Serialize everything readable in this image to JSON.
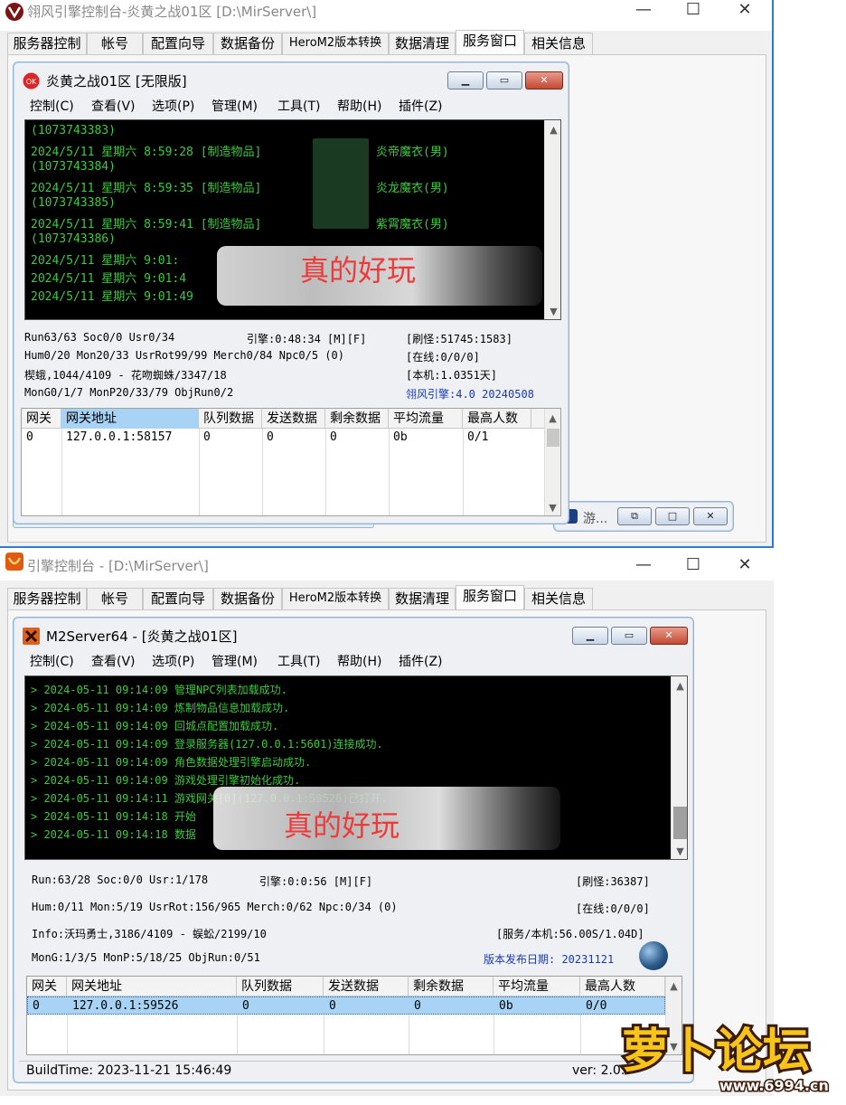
{
  "top_window": {
    "title": "翎风引擎控制台-炎黄之战01区 [D:\\MirServer\\]",
    "caption": {
      "minimize": "—",
      "maximize": "☐",
      "close": "✕"
    },
    "tabs": [
      "服务器控制",
      "帐号",
      "配置向导",
      "数据备份",
      "HeroM2版本转换",
      "数据清理",
      "服务窗口",
      "相关信息"
    ],
    "active_tab": "服务窗口",
    "child": {
      "title": "炎黄之战01区 [无限版]",
      "menus": [
        "控制(C)",
        "查看(V)",
        "选项(P)",
        "管理(M)",
        "工具(T)",
        "帮助(H)",
        "插件(Z)"
      ],
      "log": [
        "(1073743383)",
        "2024/5/11 星期六 8:59:28 [制造物品]",
        "(1073743384)",
        "2024/5/11 星期六 8:59:35 [制造物品]",
        "(1073743385)",
        "2024/5/11 星期六 8:59:41 [制造物品]",
        "(1073743386)",
        "2024/5/11 星期六 9:01:",
        "2024/5/11 星期六 9:01:4",
        "2024/5/11 星期六 9:01:49"
      ],
      "log_tail": [
        "炎帝魔衣(男)",
        "炎龙魔衣(男)",
        "紫霄魔衣(男)"
      ],
      "status": {
        "l1": "Run63/63 Soc0/0 Usr0/34",
        "engine": "引擎:0:48:34 [M][F]",
        "r1": "[刷怪:51745:1583]",
        "l2": "Hum0/20 Mon20/33 UsrRot99/99 Merch0/84 Npc0/5 (0)",
        "r2": "[在线:0/0/0]",
        "l3": "楔蛾,1044/4109 - 花吻蜘蛛/3347/18",
        "r3": "[本机:1.0351天]",
        "l4": "MonG0/1/7 MonP20/33/79 ObjRun0/2",
        "r4": "翎风引擎:4.0 20240508"
      },
      "grid": {
        "headers": [
          "网关",
          "网关地址",
          "队列数据",
          "发送数据",
          "剩余数据",
          "平均流量",
          "最高人数"
        ],
        "row": [
          "0",
          "127.0.0.1:58157",
          "0",
          "0",
          "0",
          "0b",
          "0/1"
        ]
      }
    },
    "minimized_window": {
      "title": "游..."
    }
  },
  "bottom_window": {
    "title": "引擎控制台 - [D:\\MirServer\\]",
    "caption": {
      "minimize": "—",
      "maximize": "☐",
      "close": "✕"
    },
    "tabs": [
      "服务器控制",
      "帐号",
      "配置向导",
      "数据备份",
      "HeroM2版本转换",
      "数据清理",
      "服务窗口",
      "相关信息"
    ],
    "active_tab": "服务窗口",
    "child": {
      "title": "M2Server64 - [炎黄之战01区]",
      "menus": [
        "控制(C)",
        "查看(V)",
        "选项(P)",
        "管理(M)",
        "工具(T)",
        "帮助(H)",
        "插件(Z)"
      ],
      "log": [
        "> 2024-05-11 09:14:09 管理NPC列表加载成功.",
        "> 2024-05-11 09:14:09 炼制物品信息加载成功.",
        "> 2024-05-11 09:14:09 回城点配置加载成功.",
        "> 2024-05-11 09:14:09 登录服务器(127.0.0.1:5601)连接成功.",
        "> 2024-05-11 09:14:09 角色数据处理引擎启动成功.",
        "> 2024-05-11 09:14:09 游戏处理引擎初始化成功.",
        "> 2024-05-11 09:14:11 游戏网关[0](127.0.0.1:59526)已打开.",
        "> 2024-05-11 09:14:18 开始",
        "> 2024-05-11 09:14:18 数据"
      ],
      "status": {
        "l1": "Run:63/28 Soc:0/0 Usr:1/178",
        "engine": "引擎:0:0:56 [M][F]",
        "r1": "[刷怪:36387]",
        "l2": "Hum:0/11 Mon:5/19 UsrRot:156/965 Merch:0/62 Npc:0/34 (0)",
        "r2": "[在线:0/0/0]",
        "l3": "Info:沃玛勇士,3186/4109 - 蜈蚣/2199/10",
        "r3": "[服务/本机:56.00S/1.04D]",
        "l4": "MonG:1/3/5 MonP:5/18/25 ObjRun:0/51",
        "r4": "版本发布日期: 20231121"
      },
      "grid": {
        "headers": [
          "网关",
          "网关地址",
          "队列数据",
          "发送数据",
          "剩余数据",
          "平均流量",
          "最高人数"
        ],
        "row": [
          "0",
          "127.0.0.1:59526",
          "0",
          "0",
          "0",
          "0b",
          "0/0"
        ]
      },
      "build_time": "BuildTime: 2023-11-21 15:46:49",
      "version": "ver: 2.0."
    }
  },
  "watermark": {
    "overlay_text": "真的好玩",
    "logo_text": "萝卜论坛",
    "logo_url": "www.6994.cn"
  },
  "colors": {
    "console_green": "#3ec93e",
    "overlay_red": "#f03a3a",
    "selected_row": "#a9d3f5",
    "logo_yellow": "#f7c51a"
  }
}
